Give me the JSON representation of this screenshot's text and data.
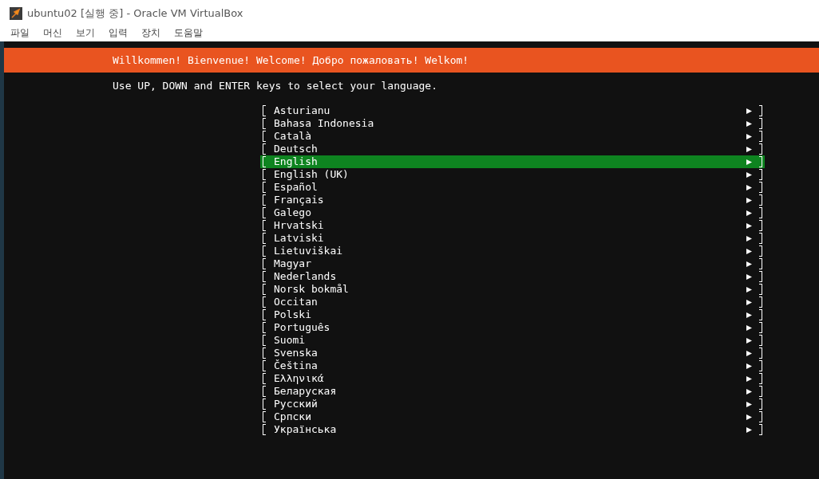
{
  "window": {
    "title": "ubuntu02 [실행 중] - Oracle VM VirtualBox"
  },
  "menu": [
    "파일",
    "머신",
    "보기",
    "입력",
    "장치",
    "도움말"
  ],
  "banner": "Willkommen! Bienvenue! Welcome! Добро пожаловать! Welkom!",
  "instruction": "Use UP, DOWN and ENTER keys to select your language.",
  "languages": [
    {
      "label": "Asturianu",
      "selected": false
    },
    {
      "label": "Bahasa Indonesia",
      "selected": false
    },
    {
      "label": "Català",
      "selected": false
    },
    {
      "label": "Deutsch",
      "selected": false
    },
    {
      "label": "English",
      "selected": true
    },
    {
      "label": "English (UK)",
      "selected": false
    },
    {
      "label": "Español",
      "selected": false
    },
    {
      "label": "Français",
      "selected": false
    },
    {
      "label": "Galego",
      "selected": false
    },
    {
      "label": "Hrvatski",
      "selected": false
    },
    {
      "label": "Latviski",
      "selected": false
    },
    {
      "label": "Lietuviškai",
      "selected": false
    },
    {
      "label": "Magyar",
      "selected": false
    },
    {
      "label": "Nederlands",
      "selected": false
    },
    {
      "label": "Norsk bokmål",
      "selected": false
    },
    {
      "label": "Occitan",
      "selected": false
    },
    {
      "label": "Polski",
      "selected": false
    },
    {
      "label": "Português",
      "selected": false
    },
    {
      "label": "Suomi",
      "selected": false
    },
    {
      "label": "Svenska",
      "selected": false
    },
    {
      "label": "Čeština",
      "selected": false
    },
    {
      "label": "Ελληνικά",
      "selected": false
    },
    {
      "label": "Беларуская",
      "selected": false
    },
    {
      "label": "Русский",
      "selected": false
    },
    {
      "label": "Српски",
      "selected": false
    },
    {
      "label": "Українська",
      "selected": false
    }
  ]
}
